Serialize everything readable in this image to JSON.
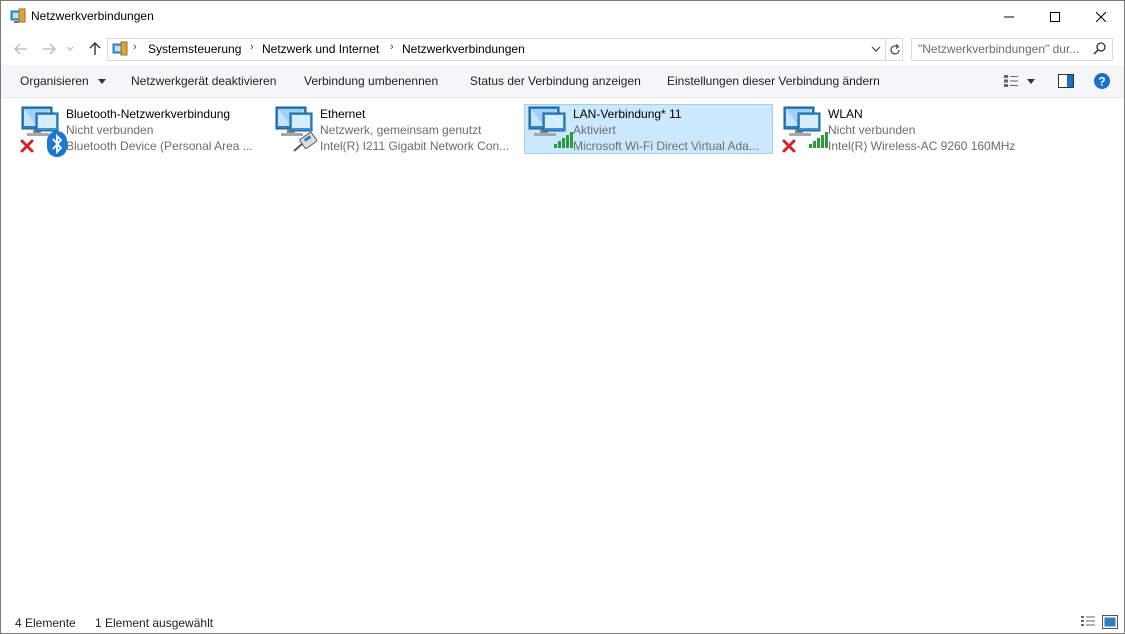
{
  "window": {
    "title": "Netzwerkverbindungen",
    "controls": [
      "minimize-icon",
      "maximize-icon",
      "close-icon"
    ]
  },
  "navigation": {
    "breadcrumb": [
      "Systemsteuerung",
      "Netzwerk und Internet",
      "Netzwerkverbindungen"
    ],
    "search_placeholder": "\"Netzwerkverbindungen\" dur..."
  },
  "commandbar": {
    "organize": "Organisieren",
    "disable": "Netzwerkgerät deaktivieren",
    "rename": "Verbindung umbenennen",
    "status": "Status der Verbindung anzeigen",
    "settings": "Einstellungen dieser Verbindung ändern"
  },
  "connections": [
    {
      "name": "Bluetooth-Netzwerkverbindung",
      "status": "Nicht verbunden",
      "device": "Bluetooth Device (Personal Area ...",
      "badge": "bluetooth-icon",
      "disconnected": true,
      "selected": false
    },
    {
      "name": "Ethernet",
      "status": "Netzwerk, gemeinsam genutzt",
      "device": "Intel(R) I211 Gigabit Network Con...",
      "badge": "ethernet-cable-icon",
      "disconnected": false,
      "selected": false
    },
    {
      "name": "LAN-Verbindung* 11",
      "status": "Aktiviert",
      "device": "Microsoft Wi-Fi Direct Virtual Ada...",
      "badge": "wifi-signal-icon",
      "disconnected": false,
      "selected": true
    },
    {
      "name": "WLAN",
      "status": "Nicht verbunden",
      "device": "Intel(R) Wireless-AC 9260 160MHz",
      "badge": "wifi-signal-icon",
      "disconnected": true,
      "selected": false
    }
  ],
  "statusbar": {
    "count": "4 Elemente",
    "selected": "1 Element ausgewählt"
  },
  "colors": {
    "selection_bg": "#cce8ff",
    "selection_border": "#99d1ff",
    "help_blue": "#1a6fc9",
    "signal_green": "#2e9b3a",
    "error_red": "#d4202a"
  }
}
